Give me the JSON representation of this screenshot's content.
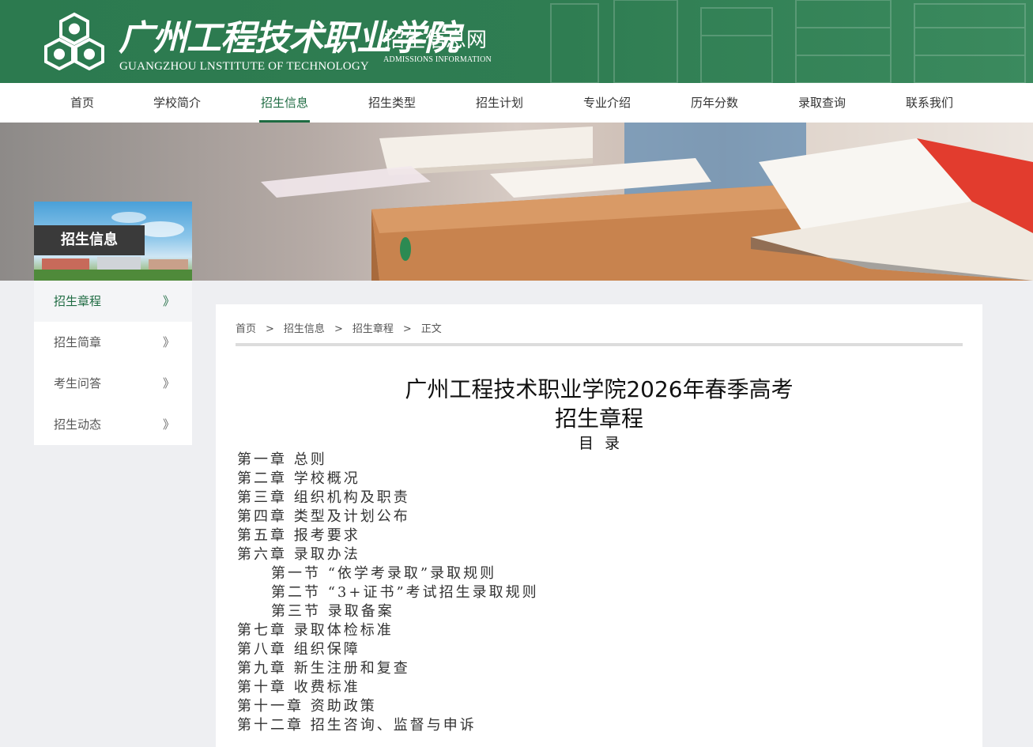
{
  "header": {
    "school_cn": "广州工程技术职业学院",
    "school_en": "GUANGZHOU LNSTITUTE OF TECHNOLOGY",
    "site_cn": "招生信息网",
    "site_en": "ADMISSIONS INFORMATION",
    "logo_icon": "hexagon-logo-icon",
    "brand_color": "#2c7a4f"
  },
  "nav": {
    "items": [
      {
        "label": "首页"
      },
      {
        "label": "学校简介"
      },
      {
        "label": "招生信息",
        "active": true
      },
      {
        "label": "招生类型"
      },
      {
        "label": "招生计划"
      },
      {
        "label": "专业介绍"
      },
      {
        "label": "历年分数"
      },
      {
        "label": "录取查询"
      },
      {
        "label": "联系我们"
      }
    ],
    "active_color": "#1e6b42"
  },
  "sidebar": {
    "title": "招生信息",
    "items": [
      {
        "label": "招生章程",
        "arrow": "》",
        "active": true
      },
      {
        "label": "招生简章",
        "arrow": "》"
      },
      {
        "label": "考生问答",
        "arrow": "》"
      },
      {
        "label": "招生动态",
        "arrow": "》"
      }
    ]
  },
  "breadcrumb": {
    "items": [
      "首页",
      "招生信息",
      "招生章程",
      "正文"
    ],
    "separator": ">"
  },
  "article": {
    "title_line1": "广州工程技术职业学院2026年春季高考",
    "title_line2": "招生章程",
    "toc_title": "目录",
    "toc": [
      {
        "text": "第一章 总则"
      },
      {
        "text": "第二章 学校概况"
      },
      {
        "text": "第三章 组织机构及职责"
      },
      {
        "text": "第四章 类型及计划公布"
      },
      {
        "text": "第五章 报考要求"
      },
      {
        "text": "第六章 录取办法"
      },
      {
        "text": "第一节 “依学考录取”录取规则",
        "sub": true
      },
      {
        "text": "第二节 “3+证书”考试招生录取规则",
        "sub": true
      },
      {
        "text": "第三节 录取备案",
        "sub": true
      },
      {
        "text": "第七章 录取体检标准"
      },
      {
        "text": "第八章 组织保障"
      },
      {
        "text": "第九章 新生注册和复查"
      },
      {
        "text": "第十章 收费标准"
      },
      {
        "text": "第十一章 资助政策"
      },
      {
        "text": "第十二章 招生咨询、监督与申诉"
      }
    ]
  }
}
